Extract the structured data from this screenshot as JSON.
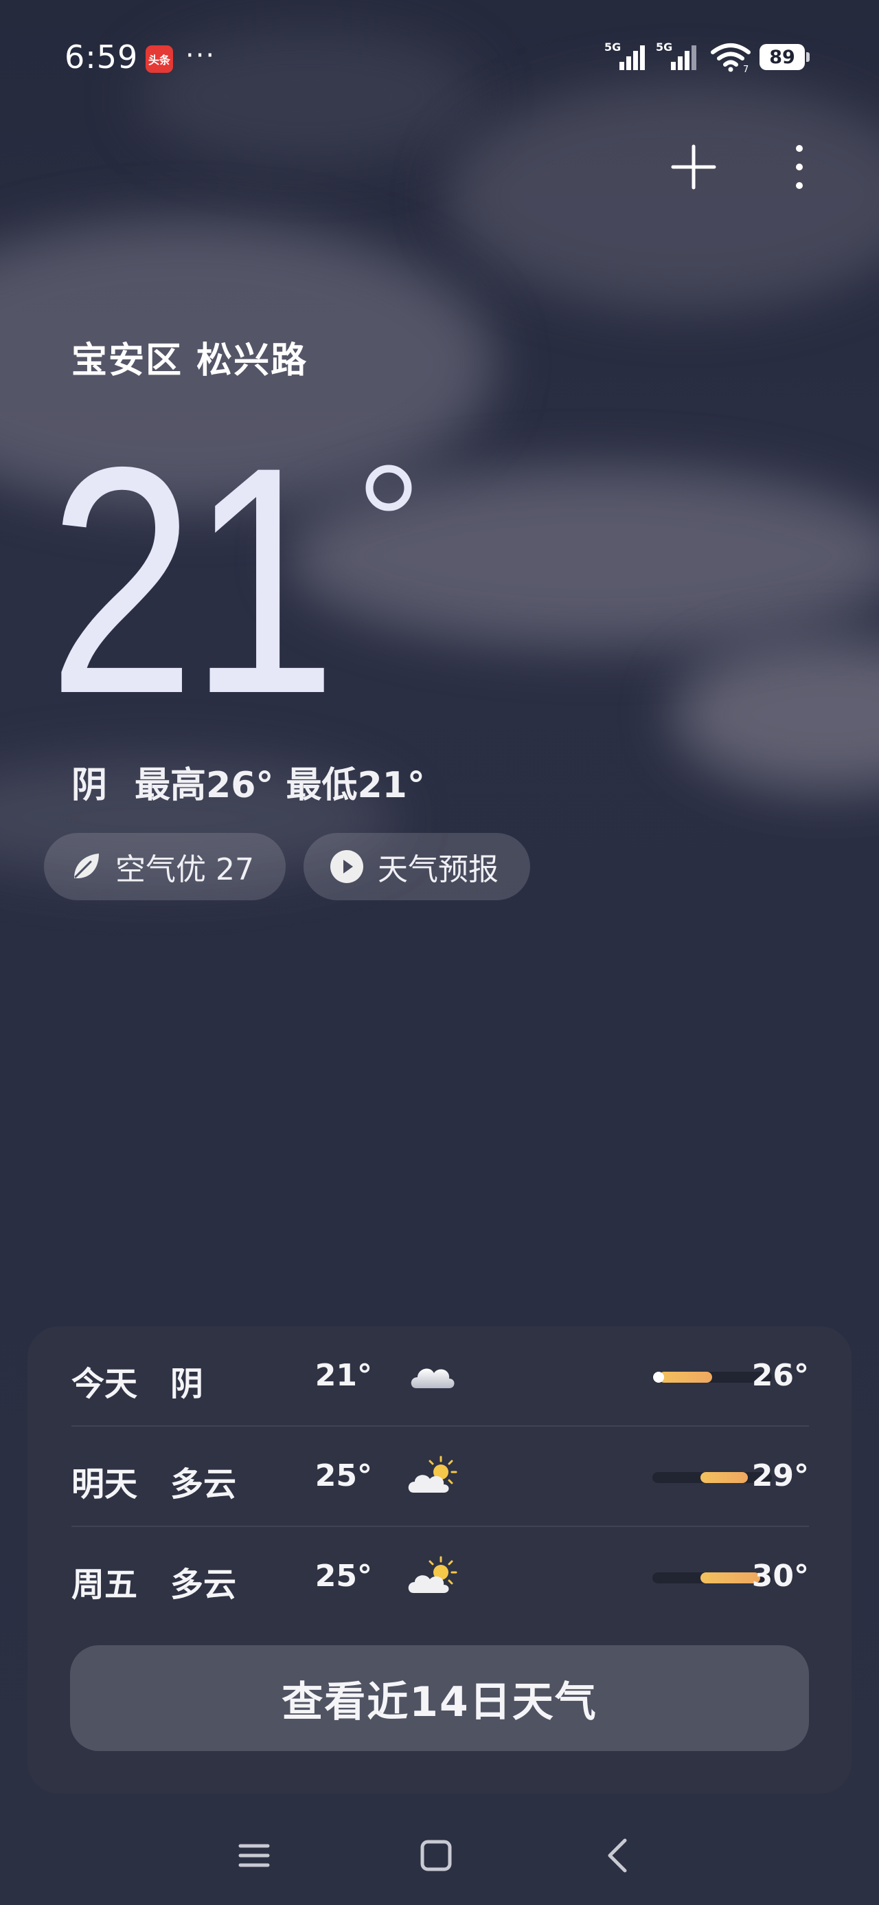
{
  "status_bar": {
    "time": "6:59",
    "notification_app_label": "头条",
    "more_notifications": "···",
    "signal_1_label": "5G",
    "signal_2_label": "5G",
    "wifi_label": "7",
    "battery": "89"
  },
  "location": "宝安区 松兴路",
  "current": {
    "temperature": "21",
    "condition": "阴",
    "high_low": "最高26° 最低21°"
  },
  "chips": {
    "air_quality": "空气优 27",
    "forecast_video": "天气预报"
  },
  "forecast": [
    {
      "day": "今天",
      "condition": "阴",
      "icon": "cloud-icon",
      "low": "21°",
      "high": "26°",
      "range_start": 0.05,
      "range_end": 0.5,
      "current_dot": 0.05
    },
    {
      "day": "明天",
      "condition": "多云",
      "icon": "partly-cloudy-icon",
      "low": "25°",
      "high": "29°",
      "range_start": 0.4,
      "range_end": 0.8
    },
    {
      "day": "周五",
      "condition": "多云",
      "icon": "partly-cloudy-icon",
      "low": "25°",
      "high": "30°",
      "range_start": 0.4,
      "range_end": 0.9
    }
  ],
  "cta_label": "查看近14日天气",
  "colors": {
    "bar_gradient_start": "#f2c15e",
    "bar_gradient_end": "#f0a860",
    "background": "#2a2e42"
  }
}
